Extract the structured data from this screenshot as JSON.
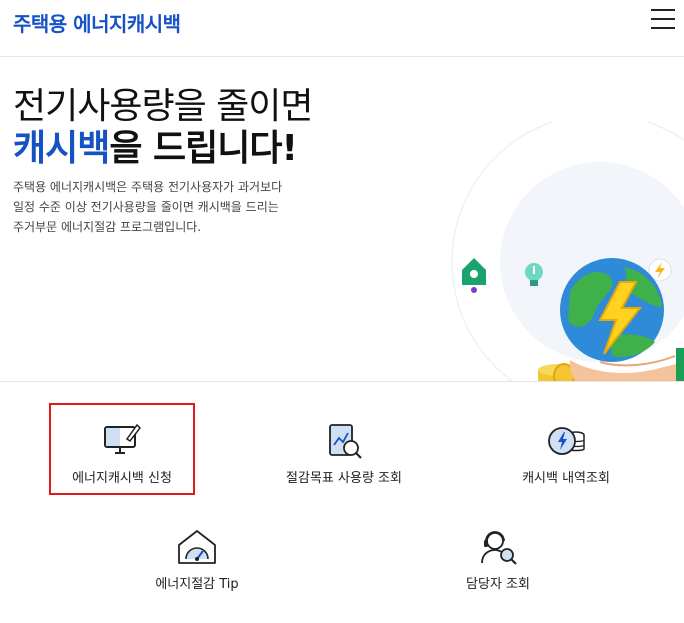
{
  "header": {
    "logo": "주택용 에너지캐시백"
  },
  "hero": {
    "title_line1": "전기사용량을 줄이면",
    "title_line2_accent": "캐시백",
    "title_line2_rest": "을 드립니다!",
    "description_lines": [
      "주택용 에너지캐시백은 주택용 전기사용자가 과거보다",
      "일정 수준 이상 전기사용량을 줄이면 캐시백을 드리는",
      "주거부문 에너지절감 프로그램입니다."
    ]
  },
  "quick_menu": {
    "apply_label": "에너지캐시백 신청",
    "goal_label": "절감목표 사용량 조회",
    "history_label": "캐시백 내역조회",
    "tip_label": "에너지절감 Tip",
    "manager_label": "담당자 조회"
  },
  "colors": {
    "brand_blue": "#1553c4",
    "selection_red": "#e0191b"
  }
}
